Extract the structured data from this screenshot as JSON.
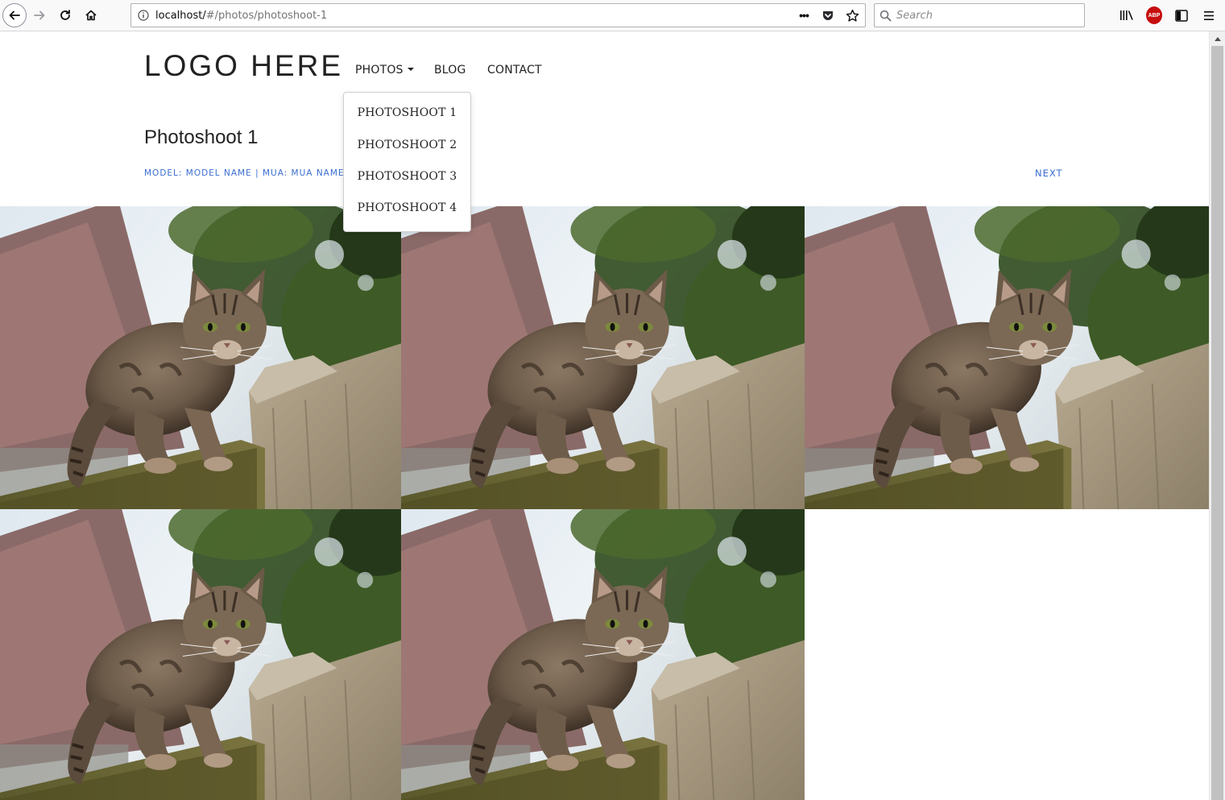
{
  "browser": {
    "url_host": "localhost/",
    "url_path": "#/photos/photoshoot-1",
    "search_placeholder": "Search",
    "page_actions_label": "•••",
    "abp_label": "ABP"
  },
  "site": {
    "logo": "LOGO HERE",
    "nav": {
      "photos": "PHOTOS",
      "blog": "BLOG",
      "contact": "CONTACT"
    },
    "dropdown": [
      {
        "label": "PHOTOSHOOT 1"
      },
      {
        "label": "PHOTOSHOOT 2"
      },
      {
        "label": "PHOTOSHOOT 3"
      },
      {
        "label": "PHOTOSHOOT 4"
      }
    ]
  },
  "main": {
    "title": "Photoshoot 1",
    "credits": "MODEL: MODEL NAME | MUA: MUA NAME",
    "next": "NEXT"
  },
  "photos": [
    {
      "subject": "tabby cat walking on wooden fence"
    },
    {
      "subject": "tabby cat walking on wooden fence"
    },
    {
      "subject": "tabby cat walking on wooden fence"
    },
    {
      "subject": "tabby cat walking on wooden fence"
    },
    {
      "subject": "tabby cat walking on wooden fence"
    }
  ],
  "colors": {
    "link_blue": "#3a6ed0",
    "text": "#222222",
    "abp_red": "#c70d0d"
  }
}
